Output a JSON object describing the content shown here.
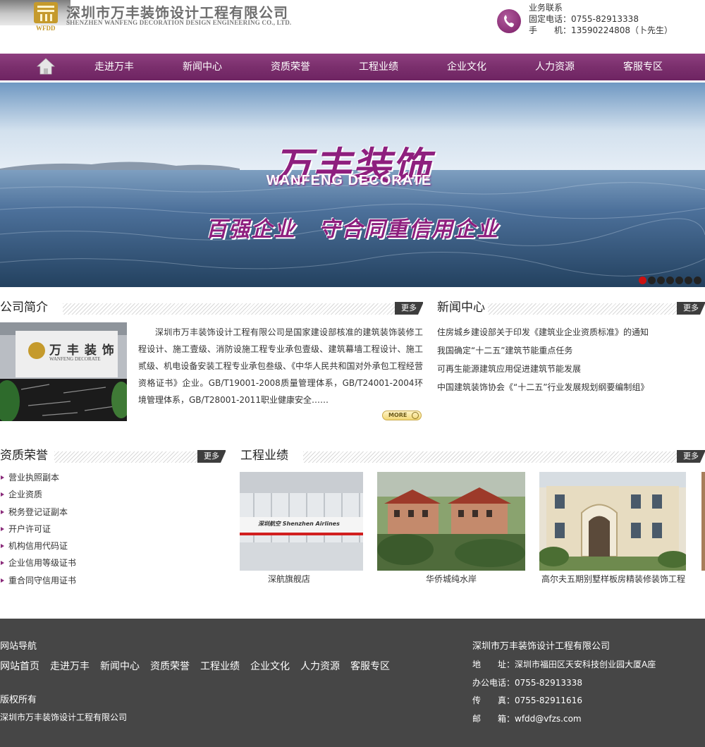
{
  "brand": {
    "logo_text": "WFDD",
    "name_cn": "深圳市万丰装饰设计工程有限公司",
    "name_en": "SHENZHEN WANFENG DECORATION DESIGN ENGINEERING CO., LTD.",
    "accent_color": "#7b2f6d"
  },
  "contact": {
    "heading": "业务联系",
    "landline": "固定电话：0755-82913338",
    "mobile": "手　　机：13590224808（卜先生）"
  },
  "nav": {
    "home_icon": "home-icon",
    "items": [
      "走进万丰",
      "新闻中心",
      "资质荣誉",
      "工程业绩",
      "企业文化",
      "人力资源",
      "客服专区"
    ]
  },
  "banner": {
    "title": "万丰装饰",
    "subtitle": "WANFENG DECORATE",
    "slogan": "百强企业　守合同重信用企业"
  },
  "about": {
    "title": "公司简介",
    "more": "更多",
    "image_sign_cn": "万 丰 装 饰",
    "image_sign_en": "WANFENG DECORATE",
    "text": "深圳市万丰装饰设计工程有限公司是国家建设部核准的建筑装饰装修工程设计、施工壹级、消防设施工程专业承包壹级、建筑幕墙工程设计、施工贰级、机电设备安装工程专业承包叁级、《中华人民共和国对外承包工程经营资格证书》企业。GB/T19001-2008质量管理体系，GB/T24001-2004环境管理体系，GB/T28001-2011职业健康安全……",
    "more_button": "MORE"
  },
  "news": {
    "title": "新闻中心",
    "more": "更多",
    "items": [
      "住房城乡建设部关于印发《建筑业企业资质标准》的通知",
      "我国确定“十二五”建筑节能重点任务",
      "可再生能源建筑应用促进建筑节能发展",
      "中国建筑装饰协会《“十二五”行业发展规划纲要编制组》"
    ]
  },
  "qualifications": {
    "title": "资质荣誉",
    "more": "更多",
    "items": [
      "营业执照副本",
      "企业资质",
      "税务登记证副本",
      "开户许可证",
      "机构信用代码证",
      "企业信用等级证书",
      "重合同守信用证书"
    ]
  },
  "projects": {
    "title": "工程业绩",
    "more": "更多",
    "items": [
      {
        "caption": "深航旗舰店",
        "sign_text": "深圳航空 Shenzhen Airlines"
      },
      {
        "caption": "华侨城纯水岸"
      },
      {
        "caption": "高尔夫五期别墅样板房精装修装饰工程"
      }
    ]
  },
  "footer": {
    "nav_title": "网站导航",
    "links": [
      "网站首页",
      "走进万丰",
      "新闻中心",
      "资质荣誉",
      "工程业绩",
      "企业文化",
      "人力资源",
      "客服专区"
    ],
    "copyright_title": "版权所有",
    "copyright_company": "深圳市万丰装饰设计工程有限公司",
    "company": "深圳市万丰装饰设计工程有限公司",
    "address": "地　　址：深圳市福田区天安科技创业园大厦A座",
    "office_phone": "办公电话：0755-82913338",
    "fax": "传　　真：0755-82911616",
    "email": "邮　　箱：wfdd@vfzs.com"
  }
}
